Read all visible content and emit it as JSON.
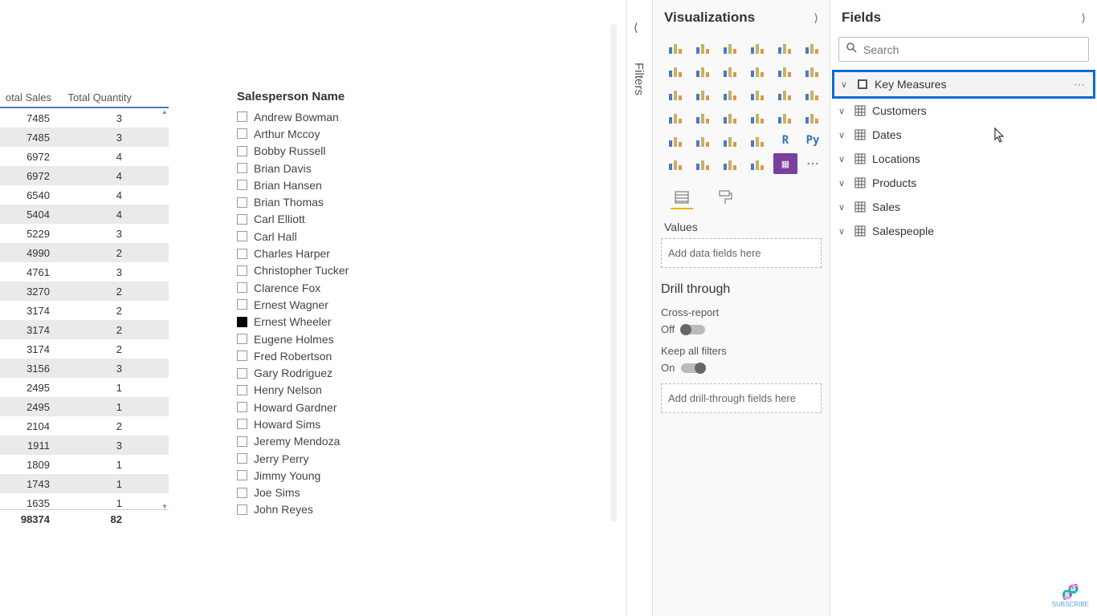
{
  "canvas": {
    "table": {
      "col_sales": "otal Sales",
      "col_qty": "Total Quantity",
      "rows": [
        {
          "sales": 7485,
          "qty": 3
        },
        {
          "sales": 7485,
          "qty": 3
        },
        {
          "sales": 6972,
          "qty": 4
        },
        {
          "sales": 6972,
          "qty": 4
        },
        {
          "sales": 6540,
          "qty": 4
        },
        {
          "sales": 5404,
          "qty": 4
        },
        {
          "sales": 5229,
          "qty": 3
        },
        {
          "sales": 4990,
          "qty": 2
        },
        {
          "sales": 4761,
          "qty": 3
        },
        {
          "sales": 3270,
          "qty": 2
        },
        {
          "sales": 3174,
          "qty": 2
        },
        {
          "sales": 3174,
          "qty": 2
        },
        {
          "sales": 3174,
          "qty": 2
        },
        {
          "sales": 3156,
          "qty": 3
        },
        {
          "sales": 2495,
          "qty": 1
        },
        {
          "sales": 2495,
          "qty": 1
        },
        {
          "sales": 2104,
          "qty": 2
        },
        {
          "sales": 1911,
          "qty": 3
        },
        {
          "sales": 1809,
          "qty": 1
        },
        {
          "sales": 1743,
          "qty": 1
        },
        {
          "sales": 1635,
          "qty": 1
        }
      ],
      "total_sales": 98374,
      "total_qty": 82
    },
    "slicer": {
      "title": "Salesperson Name",
      "items": [
        {
          "name": "Andrew Bowman",
          "checked": false
        },
        {
          "name": "Arthur Mccoy",
          "checked": false
        },
        {
          "name": "Bobby Russell",
          "checked": false
        },
        {
          "name": "Brian Davis",
          "checked": false
        },
        {
          "name": "Brian Hansen",
          "checked": false
        },
        {
          "name": "Brian Thomas",
          "checked": false
        },
        {
          "name": "Carl Elliott",
          "checked": false
        },
        {
          "name": "Carl Hall",
          "checked": false
        },
        {
          "name": "Charles Harper",
          "checked": false
        },
        {
          "name": "Christopher Tucker",
          "checked": false
        },
        {
          "name": "Clarence Fox",
          "checked": false
        },
        {
          "name": "Ernest Wagner",
          "checked": false
        },
        {
          "name": "Ernest Wheeler",
          "checked": true
        },
        {
          "name": "Eugene Holmes",
          "checked": false
        },
        {
          "name": "Fred Robertson",
          "checked": false
        },
        {
          "name": "Gary Rodriguez",
          "checked": false
        },
        {
          "name": "Henry Nelson",
          "checked": false
        },
        {
          "name": "Howard Gardner",
          "checked": false
        },
        {
          "name": "Howard Sims",
          "checked": false
        },
        {
          "name": "Jeremy Mendoza",
          "checked": false
        },
        {
          "name": "Jerry Perry",
          "checked": false
        },
        {
          "name": "Jimmy Young",
          "checked": false
        },
        {
          "name": "Joe Sims",
          "checked": false
        },
        {
          "name": "John Reyes",
          "checked": false
        }
      ]
    }
  },
  "filters": {
    "label": "Filters"
  },
  "viz": {
    "title": "Visualizations",
    "values_label": "Values",
    "values_placeholder": "Add data fields here",
    "drill_title": "Drill through",
    "cross_report_label": "Cross-report",
    "cross_report_state": "Off",
    "keep_filters_label": "Keep all filters",
    "keep_filters_state": "On",
    "drill_placeholder": "Add drill-through fields here"
  },
  "fields": {
    "title": "Fields",
    "search_placeholder": "Search",
    "tables": [
      {
        "name": "Key Measures",
        "icon": "measure",
        "highlighted": true
      },
      {
        "name": "Customers",
        "icon": "table",
        "highlighted": false
      },
      {
        "name": "Dates",
        "icon": "table",
        "highlighted": false
      },
      {
        "name": "Locations",
        "icon": "table",
        "highlighted": false
      },
      {
        "name": "Products",
        "icon": "table",
        "highlighted": false
      },
      {
        "name": "Sales",
        "icon": "table",
        "highlighted": false
      },
      {
        "name": "Salespeople",
        "icon": "table",
        "highlighted": false
      }
    ]
  },
  "subscribe": "SUBSCRIBE"
}
